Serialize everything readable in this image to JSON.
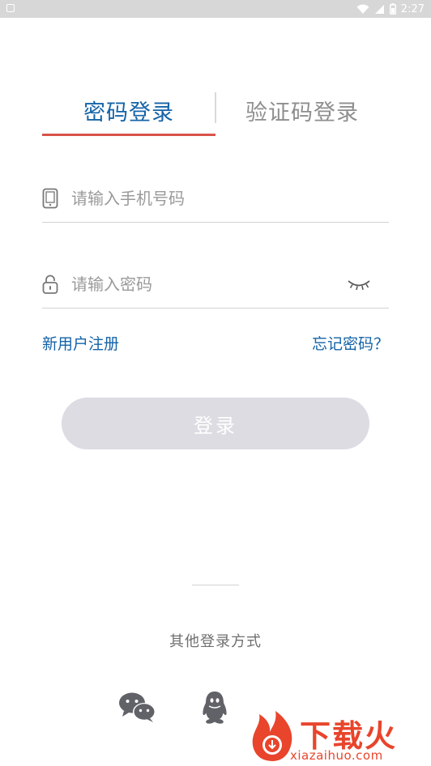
{
  "status_bar": {
    "time": "2:27",
    "icons": [
      "notification-icon",
      "wifi-icon",
      "signal-icon",
      "battery-icon"
    ]
  },
  "tabs": {
    "password_login": "密码登录",
    "code_login": "验证码登录",
    "active_color": "#1463a8",
    "inactive_color": "#8e8e8e",
    "underline_color": "#d9534a"
  },
  "phone_field": {
    "icon": "phone-icon",
    "placeholder": "请输入手机号码",
    "value": ""
  },
  "password_field": {
    "icon": "lock-icon",
    "placeholder": "请输入密码",
    "value": "",
    "toggle_icon": "eye-closed-icon"
  },
  "links": {
    "register": "新用户注册",
    "forgot": "忘记密码？"
  },
  "login_button": {
    "label": "登录",
    "color": "#dcdce2"
  },
  "other_login": {
    "label": "其他登录方式",
    "options": [
      "wechat-icon",
      "qq-icon"
    ]
  },
  "watermark": {
    "title": "下载火",
    "url": "xiazaihuo.com",
    "color": "#e8452c"
  }
}
